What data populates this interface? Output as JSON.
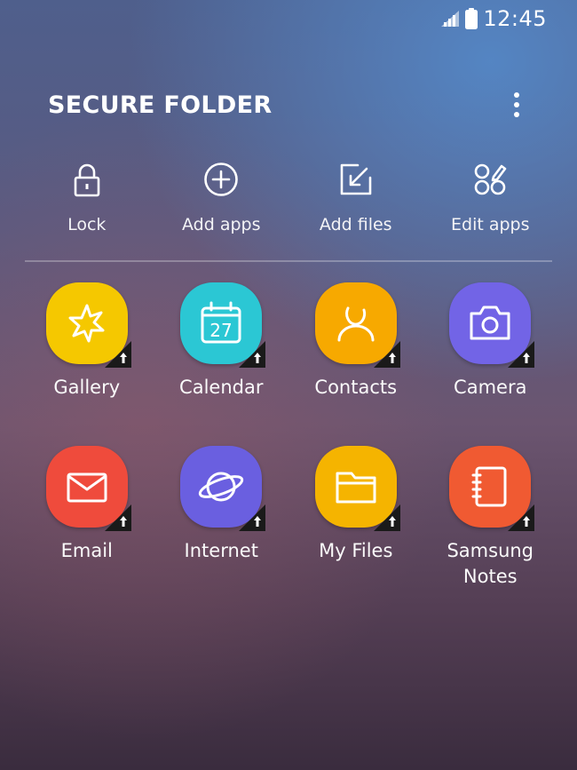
{
  "status_bar": {
    "time": "12:45",
    "signal_icon": "signal-icon",
    "battery_icon": "battery-icon"
  },
  "header": {
    "title": "SECURE FOLDER",
    "more_icon": "more-vertical-icon"
  },
  "actions": [
    {
      "label": "Lock",
      "icon": "lock-icon"
    },
    {
      "label": "Add apps",
      "icon": "add-circle-icon"
    },
    {
      "label": "Add files",
      "icon": "add-file-icon"
    },
    {
      "label": "Edit apps",
      "icon": "edit-apps-icon"
    }
  ],
  "apps": [
    {
      "label": "Gallery",
      "icon": "gallery-icon",
      "color": "#f5c800"
    },
    {
      "label": "Calendar",
      "icon": "calendar-icon",
      "color": "#2bc7d4",
      "date": "27"
    },
    {
      "label": "Contacts",
      "icon": "contacts-icon",
      "color": "#f7a900"
    },
    {
      "label": "Camera",
      "icon": "camera-icon",
      "color": "#7264e6"
    },
    {
      "label": "Email",
      "icon": "email-icon",
      "color": "#ef4b3c"
    },
    {
      "label": "Internet",
      "icon": "internet-icon",
      "color": "#6a5fe0"
    },
    {
      "label": "My Files",
      "icon": "folder-icon",
      "color": "#f5b400"
    },
    {
      "label": "Samsung Notes",
      "icon": "notes-icon",
      "color": "#f05a32"
    }
  ],
  "colors": {
    "badge": "#1a1a1a",
    "divider": "#ffffff"
  }
}
